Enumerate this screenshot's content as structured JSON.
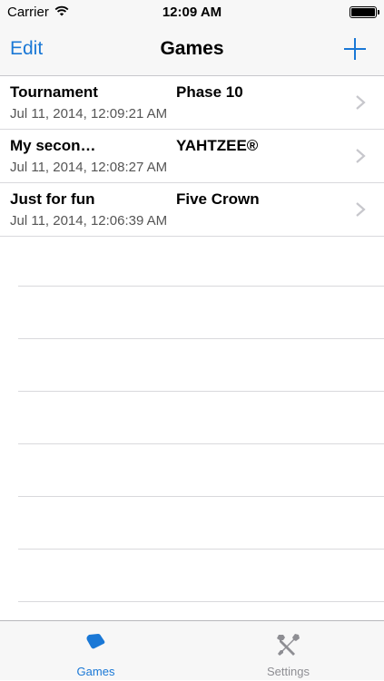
{
  "status": {
    "carrier": "Carrier",
    "time": "12:09 AM"
  },
  "nav": {
    "edit": "Edit",
    "title": "Games",
    "add_icon": "plus-icon"
  },
  "games": [
    {
      "name": "Tournament",
      "game": "Phase 10",
      "date": "Jul 11, 2014, 12:09:21 AM"
    },
    {
      "name": "My secon…",
      "game": "YAHTZEE®",
      "date": "Jul 11, 2014, 12:08:27 AM"
    },
    {
      "name": "Just for fun",
      "game": "Five Crown",
      "date": "Jul 11, 2014, 12:06:39 AM"
    }
  ],
  "tabs": {
    "games": "Games",
    "settings": "Settings"
  },
  "colors": {
    "accent": "#1a78d6",
    "inactive": "#8e8e93"
  }
}
